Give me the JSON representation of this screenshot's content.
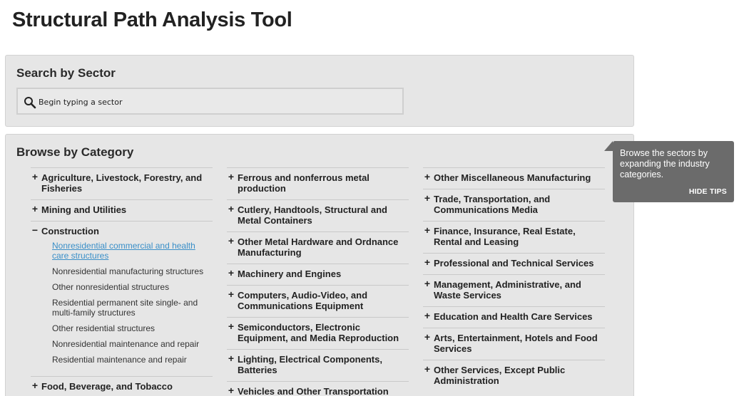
{
  "page": {
    "title": "Structural Path Analysis Tool"
  },
  "search": {
    "heading": "Search by Sector",
    "placeholder": "Begin typing a sector"
  },
  "browse": {
    "heading": "Browse by Category",
    "columns": [
      [
        {
          "label": "Agriculture, Livestock, Forestry, and Fisheries",
          "toggle": "+"
        },
        {
          "label": "Mining and Utilities",
          "toggle": "+"
        },
        {
          "label": "Construction",
          "toggle": "−",
          "subs": [
            "Nonresidential commercial and health care structures",
            "Nonresidential manufacturing structures",
            "Other nonresidential structures",
            "Residential permanent site single- and multi-family structures",
            "Other residential structures",
            "Nonresidential maintenance and repair",
            "Residential maintenance and repair"
          ]
        },
        {
          "label": "Food, Beverage, and Tobacco",
          "toggle": "+"
        }
      ],
      [
        {
          "label": "Ferrous and nonferrous metal production",
          "toggle": "+"
        },
        {
          "label": "Cutlery, Handtools, Structural and Metal Containers",
          "toggle": "+"
        },
        {
          "label": "Other Metal Hardware and Ordnance Manufacturing",
          "toggle": "+"
        },
        {
          "label": "Machinery and Engines",
          "toggle": "+"
        },
        {
          "label": "Computers, Audio-Video, and Communications Equipment",
          "toggle": "+"
        },
        {
          "label": "Semiconductors, Electronic Equipment, and Media Reproduction",
          "toggle": "+"
        },
        {
          "label": "Lighting, Electrical Components, Batteries",
          "toggle": "+"
        },
        {
          "label": "Vehicles and Other Transportation",
          "toggle": "+"
        }
      ],
      [
        {
          "label": "Other Miscellaneous Manufacturing",
          "toggle": "+"
        },
        {
          "label": "Trade, Transportation, and Communications Media",
          "toggle": "+"
        },
        {
          "label": "Finance, Insurance, Real Estate, Rental and Leasing",
          "toggle": "+"
        },
        {
          "label": "Professional and Technical Services",
          "toggle": "+"
        },
        {
          "label": "Management, Administrative, and Waste Services",
          "toggle": "+"
        },
        {
          "label": "Education and Health Care Services",
          "toggle": "+"
        },
        {
          "label": "Arts, Entertainment, Hotels and Food Services",
          "toggle": "+"
        },
        {
          "label": "Other Services, Except Public Administration",
          "toggle": "+"
        }
      ]
    ]
  },
  "tip": {
    "text": "Browse the sectors by expanding the industry categories.",
    "hide_label": "HIDE TIPS"
  },
  "colors": {
    "panel": "#e6e6e6",
    "link": "#3a8fc8",
    "tip": "#6b6b6b"
  }
}
